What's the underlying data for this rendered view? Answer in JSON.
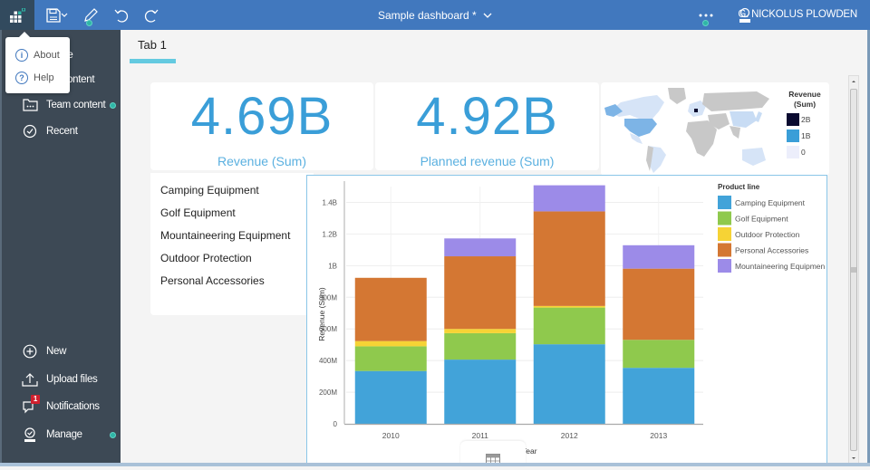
{
  "topbar": {
    "title": "Sample dashboard *",
    "user_name": "G. NICKOLUS PLOWDEN",
    "icons": [
      "app-logo-icon",
      "save-icon",
      "edit-pencil-icon",
      "undo-icon",
      "redo-icon",
      "more-icon",
      "user-icon"
    ]
  },
  "popup": {
    "items": [
      {
        "label": "About",
        "icon": "info-icon",
        "glyph": "i"
      },
      {
        "label": "Help",
        "icon": "help-icon",
        "glyph": "?"
      }
    ]
  },
  "sidebar": {
    "top_items": [
      {
        "label": "Home",
        "icon": "home-icon"
      },
      {
        "label": "My content",
        "icon": "my-content-icon"
      },
      {
        "label": "Team content",
        "icon": "team-content-icon"
      },
      {
        "label": "Recent",
        "icon": "recent-icon"
      }
    ],
    "bottom_items": [
      {
        "label": "New",
        "icon": "plus-circle-icon"
      },
      {
        "label": "Upload files",
        "icon": "upload-icon"
      },
      {
        "label": "Notifications",
        "icon": "notifications-icon",
        "badge": "1"
      },
      {
        "label": "Manage",
        "icon": "manage-icon"
      }
    ]
  },
  "tabs": [
    {
      "label": "Tab 1",
      "active": true
    }
  ],
  "kpis": [
    {
      "value": "4.69B",
      "label": "Revenue (Sum)"
    },
    {
      "value": "4.92B",
      "label": "Planned revenue (Sum)"
    }
  ],
  "map": {
    "legend_title_1": "Revenue",
    "legend_title_2": "(Sum)",
    "legend": [
      {
        "label": "2B",
        "color": "#0a0a30"
      },
      {
        "label": "1B",
        "color": "#3a9ed8"
      },
      {
        "label": "0",
        "color": "#eceefb"
      }
    ]
  },
  "product_list": [
    "Camping Equipment",
    "Golf Equipment",
    "Mountaineering Equipment",
    "Outdoor Protection",
    "Personal Accessories"
  ],
  "colors": {
    "accent": "#4178be",
    "sidebar": "#3d4955",
    "tab_underline": "#64cae0",
    "kpi": "#3a9ed8",
    "status_dot": "#2fb5a6",
    "badge": "#d0202e"
  },
  "chart_data": {
    "type": "bar",
    "stacked": true,
    "title": "",
    "xlabel": "Year",
    "ylabel": "Revenue (Sum)",
    "categories": [
      "2010",
      "2011",
      "2012",
      "2013"
    ],
    "ylim": [
      0,
      1500000000
    ],
    "yticks": [
      {
        "value": 0,
        "label": "0"
      },
      {
        "value": 200000000,
        "label": "200M"
      },
      {
        "value": 400000000,
        "label": "400M"
      },
      {
        "value": 600000000,
        "label": "600M"
      },
      {
        "value": 800000000,
        "label": "800M"
      },
      {
        "value": 1000000000,
        "label": "1B"
      },
      {
        "value": 1200000000,
        "label": "1.2B"
      },
      {
        "value": 1400000000,
        "label": "1.4B"
      }
    ],
    "grid": true,
    "legend_title": "Product line",
    "legend_position": "right",
    "series": [
      {
        "name": "Camping Equipment",
        "color": "#42a3d9",
        "values": [
          334000000,
          406000000,
          503000000,
          354000000
        ]
      },
      {
        "name": "Golf Equipment",
        "color": "#8fc94d",
        "values": [
          156000000,
          167000000,
          232000000,
          177000000
        ]
      },
      {
        "name": "Outdoor Protection",
        "color": "#f6d335",
        "values": [
          33000000,
          27000000,
          10000000,
          0
        ]
      },
      {
        "name": "Personal Accessories",
        "color": "#d47733",
        "values": [
          400000000,
          459000000,
          598000000,
          450000000
        ]
      },
      {
        "name": "Mountaineering Equipment",
        "color": "#9c8be8",
        "values": [
          0,
          113000000,
          165000000,
          148000000
        ]
      }
    ],
    "legend_labels": [
      "Camping Equipment",
      "Golf Equipment",
      "Outdoor Protection",
      "Personal Accessories",
      "Mountaineering Equipmen"
    ]
  }
}
